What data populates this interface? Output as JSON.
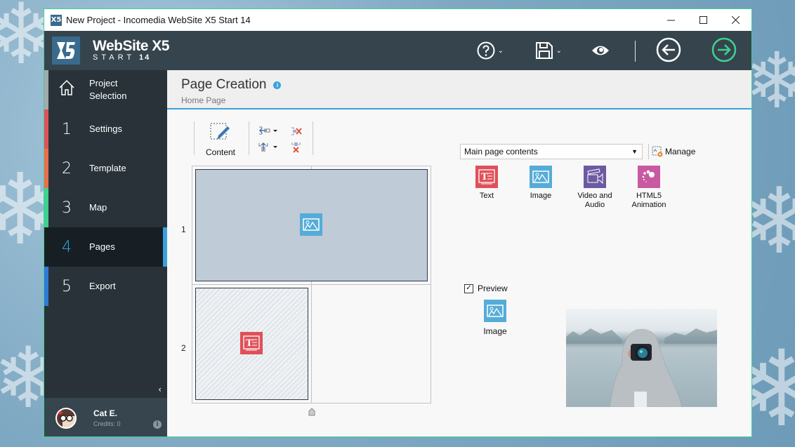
{
  "window": {
    "title": "New Project - Incomedia WebSite X5 Start 14",
    "controls": [
      "minimize",
      "maximize",
      "close"
    ]
  },
  "header": {
    "brand_name": "WebSite X5",
    "brand_edition": "START",
    "brand_version": "14",
    "tools": [
      {
        "icon": "help-icon",
        "has_dropdown": true
      },
      {
        "icon": "save-icon",
        "has_dropdown": true
      },
      {
        "icon": "preview-eye-icon",
        "has_dropdown": false
      },
      {
        "icon": "back-arrow-icon",
        "has_dropdown": false
      },
      {
        "icon": "forward-arrow-icon",
        "has_dropdown": false
      }
    ],
    "forward_color": "#3fd18f"
  },
  "sidebar": {
    "items": [
      {
        "num": "",
        "label": "Project Selection",
        "color": "#a3aaae",
        "icon": "home-icon"
      },
      {
        "num": "1",
        "label": "Settings",
        "color": "#e0505a"
      },
      {
        "num": "2",
        "label": "Template",
        "color": "#ec6e4a"
      },
      {
        "num": "3",
        "label": "Map",
        "color": "#3fd18f"
      },
      {
        "num": "4",
        "label": "Pages",
        "color": "#171f25",
        "active": true
      },
      {
        "num": "5",
        "label": "Export",
        "color": "#2f7ad8"
      }
    ],
    "accent_color": "#3aa3dc",
    "user": {
      "name": "Cat E.",
      "credits": "Credits: 0"
    }
  },
  "main": {
    "title": "Page Creation",
    "breadcrumb": "Home Page",
    "toolbar": {
      "content_label": "Content"
    },
    "grid": {
      "rows": [
        "1",
        "2"
      ],
      "objects": [
        {
          "row": 1,
          "type": "image"
        },
        {
          "row": 2,
          "type": "text"
        }
      ]
    },
    "object_panel": {
      "category": "Main page contents",
      "manage_label": "Manage",
      "objects": [
        {
          "label": "Text",
          "color": "#e0505a"
        },
        {
          "label": "Image",
          "color": "#55acd8"
        },
        {
          "label": "Video and Audio",
          "color": "#6d5aa3"
        },
        {
          "label": "HTML5 Animation",
          "color": "#c85aa0"
        }
      ]
    },
    "preview": {
      "label": "Preview",
      "checked": true,
      "selected_object": "Image"
    }
  }
}
